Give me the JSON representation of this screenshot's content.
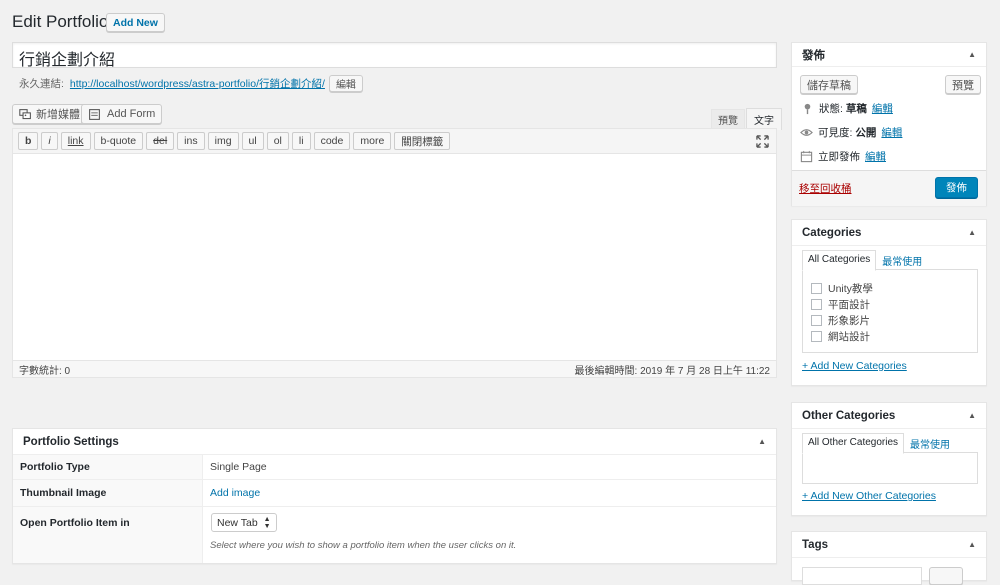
{
  "header": {
    "title": "Edit Portfolio",
    "add_new": "Add New"
  },
  "post": {
    "title_value": "行銷企劃介紹",
    "permalink_label": "永久連結:",
    "permalink_url": "http://localhost/wordpress/astra-portfolio/行銷企劃介紹/",
    "permalink_edit": "編輯"
  },
  "editor": {
    "add_media": "新增媒體",
    "add_form": "Add Form",
    "tab_visual": "預覽",
    "tab_text": "文字",
    "quicktags": [
      "b",
      "i",
      "link",
      "b-quote",
      "del",
      "ins",
      "img",
      "ul",
      "ol",
      "li",
      "code",
      "more",
      "關閉標籤"
    ],
    "word_count": "字數統計: 0",
    "last_edited": "最後編輯時間: 2019 年 7 月 28 日上午 11:22"
  },
  "portfolio_settings": {
    "title": "Portfolio Settings",
    "rows": [
      {
        "label": "Portfolio Type",
        "value": "Single Page"
      },
      {
        "label": "Thumbnail Image",
        "value": "Add image"
      },
      {
        "label": "Open Portfolio Item in",
        "value": "New Tab",
        "help": "Select where you wish to show a portfolio item when the user clicks on it."
      }
    ]
  },
  "publish": {
    "title": "發佈",
    "save_draft": "儲存草稿",
    "preview": "預覽",
    "status_label": "狀態:",
    "status_value": "草稿",
    "visibility_label": "可見度:",
    "visibility_value": "公開",
    "schedule_label": "立即發佈",
    "edit": "編輯",
    "trash": "移至回收桶",
    "publish": "發佈"
  },
  "categories": {
    "title": "Categories",
    "tab_all": "All Categories",
    "tab_popular": "最常使用",
    "items": [
      "Unity教學",
      "平面設計",
      "形象影片",
      "網站設計"
    ],
    "add_new": "+ Add New Categories"
  },
  "other_categories": {
    "title": "Other Categories",
    "tab_all": "All Other Categories",
    "tab_popular": "最常使用",
    "add_new": "+ Add New Other Categories"
  },
  "tags": {
    "title": "Tags"
  },
  "colors": {
    "primary": "#0085ba",
    "link": "#0073aa",
    "trash": "#a00"
  }
}
